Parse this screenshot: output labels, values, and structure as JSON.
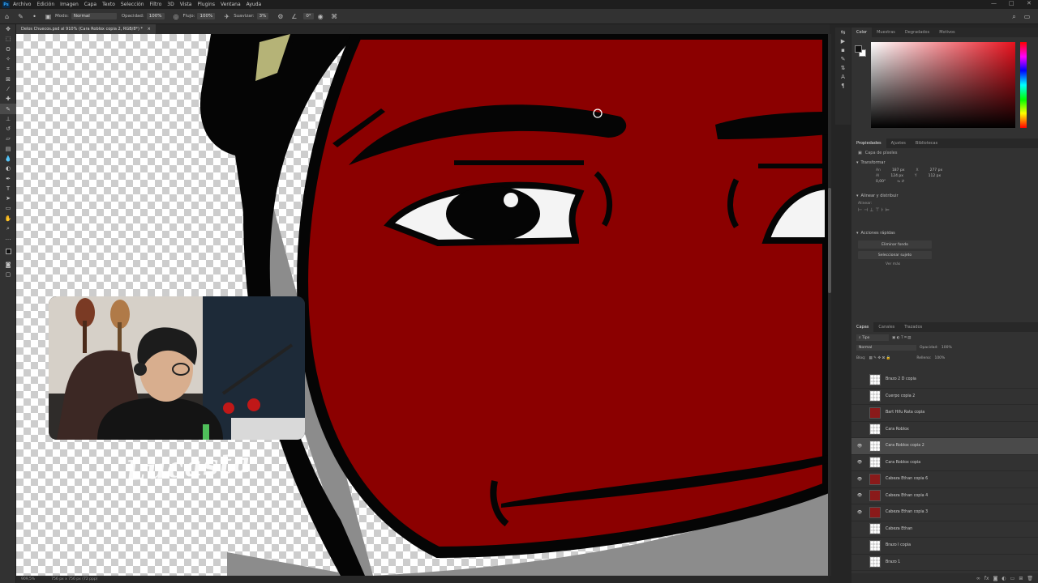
{
  "menubar": {
    "logo": "Ps",
    "items": [
      "Archivo",
      "Edición",
      "Imagen",
      "Capa",
      "Texto",
      "Selección",
      "Filtro",
      "3D",
      "Vista",
      "Plugins",
      "Ventana",
      "Ayuda"
    ],
    "minimize": "—",
    "maximize": "□",
    "close": "✕"
  },
  "options": {
    "mode_label": "Modo:",
    "mode_value": "Normal",
    "opacity_label": "Opacidad:",
    "opacity_value": "100%",
    "flow_label": "Flujo:",
    "flow_value": "100%",
    "smoothing_label": "Suavizar:",
    "smoothing_value": "3%",
    "angle_value": "0°"
  },
  "document": {
    "tab_title": "Delos Chuecos.psd al 910% (Cara Roblox copia 2, RGB/8*) *",
    "zoom": "909,5%",
    "doc_size": "756 px x 756 px (72 ppp)"
  },
  "color_panel": {
    "tabs": [
      "Color",
      "Muestras",
      "Degradados",
      "Motivos"
    ],
    "active_tab": "Color"
  },
  "properties": {
    "tabs": [
      "Propiedades",
      "Ajustes",
      "Bibliotecas"
    ],
    "active_tab": "Propiedades",
    "layer_type": "Capa de píxeles",
    "transform_title": "Transformar",
    "w_label": "An",
    "w_value": "187 px",
    "h_label": "Al",
    "h_value": "124 px",
    "x_label": "X",
    "x_value": "277 px",
    "y_label": "Y",
    "y_value": "112 px",
    "angle_value": "0,00°",
    "align_title": "Alinear y distribuir",
    "align_sub": "Alinear:",
    "quick_title": "Acciones rápidas",
    "remove_bg": "Eliminar fondo",
    "select_subject": "Seleccionar sujeto",
    "more": "Ver más"
  },
  "layers_panel": {
    "tabs": [
      "Capas",
      "Canales",
      "Trazados"
    ],
    "active_tab": "Capas",
    "filter_value": "Tipo",
    "blend_value": "Normal",
    "opacity_label": "Opacidad:",
    "opacity_value": "100%",
    "lock_label": "Bloq:",
    "fill_label": "Relleno:",
    "fill_value": "100%",
    "layers": [
      {
        "name": "Brazo 2 D copia",
        "visible": false,
        "selected": false,
        "thumb": "checker"
      },
      {
        "name": "Cuerpo copia 2",
        "visible": false,
        "selected": false,
        "thumb": "checker"
      },
      {
        "name": "Bart Hifu Rata copia",
        "visible": false,
        "selected": false,
        "thumb": "red"
      },
      {
        "name": "Cara Roblox",
        "visible": false,
        "selected": false,
        "thumb": "checker"
      },
      {
        "name": "Cara Roblox copia 2",
        "visible": true,
        "selected": true,
        "thumb": "checker"
      },
      {
        "name": "Cara Roblox copia",
        "visible": true,
        "selected": false,
        "thumb": "checker"
      },
      {
        "name": "Cabeza Ethan copia 6",
        "visible": true,
        "selected": false,
        "thumb": "red"
      },
      {
        "name": "Cabeza Ethan copia 4",
        "visible": true,
        "selected": false,
        "thumb": "red"
      },
      {
        "name": "Cabeza Ethan copia 3",
        "visible": true,
        "selected": false,
        "thumb": "red"
      },
      {
        "name": "Cabeza Ethan",
        "visible": false,
        "selected": false,
        "thumb": "checker"
      },
      {
        "name": "Brazo I copia",
        "visible": false,
        "selected": false,
        "thumb": "checker"
      },
      {
        "name": "Brazo 1",
        "visible": false,
        "selected": false,
        "thumb": "checker"
      }
    ]
  },
  "overlay": {
    "watermark": "Lucasta"
  },
  "colors": {
    "face_red": "#8b0000",
    "outline": "#050505",
    "selection_bg": "#4a4a4a"
  }
}
